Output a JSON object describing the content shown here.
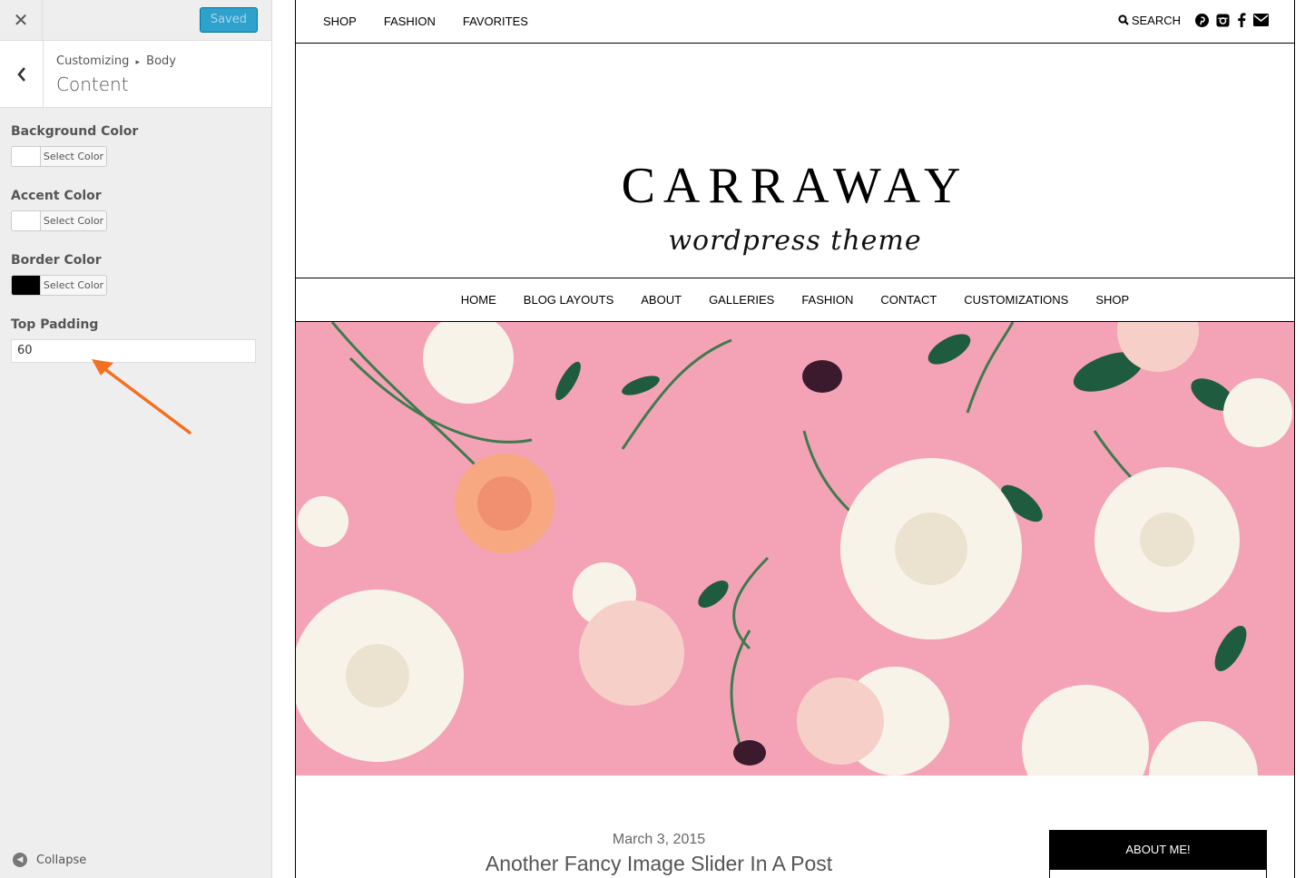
{
  "customizer": {
    "close_icon": "close-icon",
    "saved_label": "Saved",
    "breadcrumb": {
      "parent": "Customizing",
      "separator": "▸",
      "current": "Body"
    },
    "section_title": "Content",
    "controls": {
      "background_color": {
        "label": "Background Color",
        "button": "Select Color",
        "swatch": "#ffffff"
      },
      "accent_color": {
        "label": "Accent Color",
        "button": "Select Color",
        "swatch": "#ffffff"
      },
      "border_color": {
        "label": "Border Color",
        "button": "Select Color",
        "swatch": "#000000"
      },
      "top_padding": {
        "label": "Top Padding",
        "value": "60"
      }
    },
    "collapse_label": "Collapse",
    "annotation_arrow_color": "#f37021"
  },
  "site": {
    "top_nav": [
      "SHOP",
      "FASHION",
      "FAVORITES"
    ],
    "search_label": "SEARCH",
    "social_icons": [
      "pinterest-icon",
      "instagram-icon",
      "facebook-icon",
      "envelope-icon"
    ],
    "logo_title": "CARRAWAY",
    "logo_tagline": "wordpress theme",
    "main_nav": [
      "HOME",
      "BLOG LAYOUTS",
      "ABOUT",
      "GALLERIES",
      "FASHION",
      "CONTACT",
      "CUSTOMIZATIONS",
      "SHOP"
    ],
    "hero_background": "#f4a3b7",
    "post": {
      "date": "March 3, 2015",
      "title": "Another Fancy Image Slider In A Post"
    },
    "widget_title": "ABOUT ME!"
  }
}
